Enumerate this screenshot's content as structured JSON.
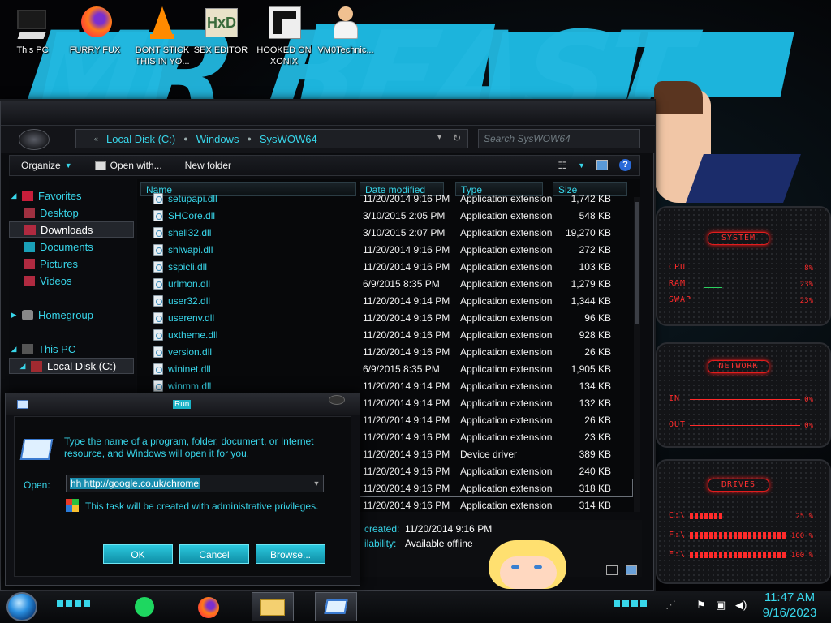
{
  "desktop": {
    "icons": [
      {
        "label": "This PC"
      },
      {
        "label": "FURRY FUX"
      },
      {
        "label": "DONT STICK THIS IN YO..."
      },
      {
        "label": "SEX EDITOR"
      },
      {
        "label": "HOOKED ON XONIX"
      },
      {
        "label": "VM0Technic..."
      }
    ],
    "wallpaper_text": "MR BEAST"
  },
  "explorer": {
    "breadcrumb": [
      "Local Disk (C:)",
      "Windows",
      "SysWOW64"
    ],
    "search_placeholder": "Search SysWOW64",
    "toolbar": {
      "organize": "Organize",
      "open_with": "Open with...",
      "new_folder": "New folder"
    },
    "nav": {
      "favorites": "Favorites",
      "desktop": "Desktop",
      "downloads": "Downloads",
      "documents": "Documents",
      "pictures": "Pictures",
      "videos": "Videos",
      "homegroup": "Homegroup",
      "this_pc": "This PC",
      "local_disk": "Local Disk (C:)"
    },
    "columns": {
      "name": "Name",
      "date": "Date modified",
      "type": "Type",
      "size": "Size"
    },
    "files": [
      {
        "name": "setupapi.dll",
        "date": "11/20/2014 9:16 PM",
        "type": "Application extension",
        "size": "1,742 KB"
      },
      {
        "name": "SHCore.dll",
        "date": "3/10/2015 2:05 PM",
        "type": "Application extension",
        "size": "548 KB"
      },
      {
        "name": "shell32.dll",
        "date": "3/10/2015 2:07 PM",
        "type": "Application extension",
        "size": "19,270 KB"
      },
      {
        "name": "shlwapi.dll",
        "date": "11/20/2014 9:16 PM",
        "type": "Application extension",
        "size": "272 KB"
      },
      {
        "name": "sspicli.dll",
        "date": "11/20/2014 9:16 PM",
        "type": "Application extension",
        "size": "103 KB"
      },
      {
        "name": "urlmon.dll",
        "date": "6/9/2015 8:35 PM",
        "type": "Application extension",
        "size": "1,279 KB"
      },
      {
        "name": "user32.dll",
        "date": "11/20/2014 9:14 PM",
        "type": "Application extension",
        "size": "1,344 KB"
      },
      {
        "name": "userenv.dll",
        "date": "11/20/2014 9:16 PM",
        "type": "Application extension",
        "size": "96 KB"
      },
      {
        "name": "uxtheme.dll",
        "date": "11/20/2014 9:16 PM",
        "type": "Application extension",
        "size": "928 KB"
      },
      {
        "name": "version.dll",
        "date": "11/20/2014 9:16 PM",
        "type": "Application extension",
        "size": "26 KB"
      },
      {
        "name": "wininet.dll",
        "date": "6/9/2015 8:35 PM",
        "type": "Application extension",
        "size": "1,905 KB"
      },
      {
        "name": "winmm.dll",
        "date": "11/20/2014 9:14 PM",
        "type": "Application extension",
        "size": "134 KB"
      },
      {
        "name": "",
        "date": "11/20/2014 9:14 PM",
        "type": "Application extension",
        "size": "132 KB"
      },
      {
        "name": "",
        "date": "11/20/2014 9:14 PM",
        "type": "Application extension",
        "size": "26 KB"
      },
      {
        "name": "",
        "date": "11/20/2014 9:16 PM",
        "type": "Application extension",
        "size": "23 KB"
      },
      {
        "name": "",
        "date": "11/20/2014 9:16 PM",
        "type": "Device driver",
        "size": "389 KB"
      },
      {
        "name": "",
        "date": "11/20/2014 9:16 PM",
        "type": "Application extension",
        "size": "240 KB"
      },
      {
        "name": "",
        "date": "11/20/2014 9:16 PM",
        "type": "Application extension",
        "size": "318 KB"
      },
      {
        "name": "",
        "date": "11/20/2014 9:16 PM",
        "type": "Application extension",
        "size": "314 KB"
      }
    ],
    "details": {
      "created_label": "created:",
      "created_value": "11/20/2014 9:16 PM",
      "availability_label": "ilability:",
      "availability_value": "Available offline"
    }
  },
  "run": {
    "title": "Run",
    "description": "Type the name of a program, folder, document, or Internet resource, and Windows will open it for you.",
    "open_label": "Open:",
    "open_value": "hh http://google.co.uk/chrome",
    "admin_note": "This task will be created with administrative privileges.",
    "ok": "OK",
    "cancel": "Cancel",
    "browse": "Browse..."
  },
  "gadgets": {
    "system": {
      "title": "SYSTEM",
      "cpu_label": "CPU",
      "cpu": "8%",
      "ram_label": "RAM",
      "ram": "23%",
      "swap_label": "SWAP",
      "swap": "23%"
    },
    "network": {
      "title": "NETWORK",
      "in_label": "IN",
      "in": "0%",
      "out_label": "OUT",
      "out": "0%"
    },
    "drives": {
      "title": "DRIVES",
      "c_label": "C:\\",
      "c": "25 %",
      "f_label": "F:\\",
      "f": "100 %",
      "e_label": "E:\\",
      "e": "100 %"
    }
  },
  "taskbar": {
    "time": "11:47 AM",
    "date": "9/16/2023"
  },
  "colors": {
    "accent": "#38d6ea",
    "gadget_red": "#ff2a2a",
    "brush_blue": "#22b8e0"
  }
}
